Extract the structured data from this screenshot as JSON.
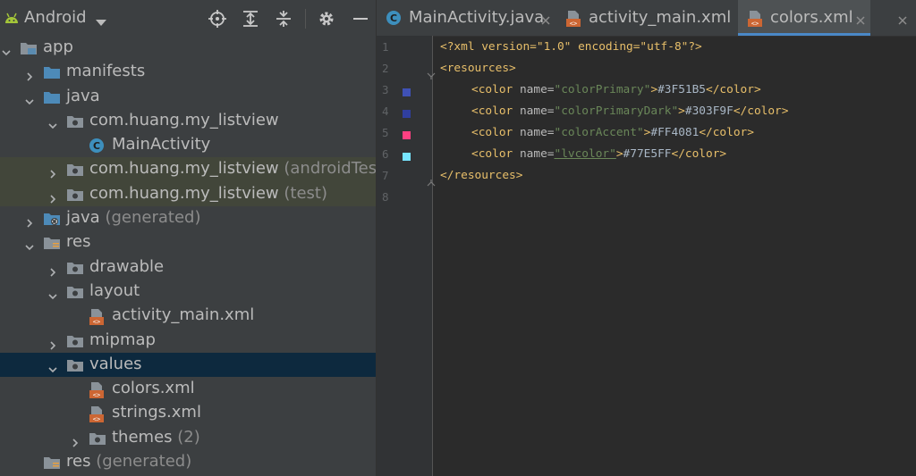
{
  "project": {
    "title": "Android",
    "tree": [
      {
        "label": "app",
        "icon": "module-folder-icon",
        "expanded": true
      },
      {
        "label": "manifests",
        "icon": "folder-icon",
        "expanded": false
      },
      {
        "label": "java",
        "icon": "folder-icon",
        "expanded": true
      },
      {
        "label": "com.huang.my_listview",
        "icon": "package-icon",
        "expanded": true
      },
      {
        "label": "MainActivity",
        "icon": "java-class-icon"
      },
      {
        "label": "com.huang.my_listview",
        "suffix": "(androidTest)",
        "icon": "package-icon",
        "expanded": false
      },
      {
        "label": "com.huang.my_listview",
        "suffix": "(test)",
        "icon": "package-icon",
        "expanded": false
      },
      {
        "label": "java",
        "suffix": "(generated)",
        "icon": "generated-folder-icon",
        "expanded": false
      },
      {
        "label": "res",
        "icon": "res-folder-icon",
        "expanded": true
      },
      {
        "label": "drawable",
        "icon": "package-icon",
        "expanded": false
      },
      {
        "label": "layout",
        "icon": "package-icon",
        "expanded": true
      },
      {
        "label": "activity_main.xml",
        "icon": "xml-file-icon"
      },
      {
        "label": "mipmap",
        "icon": "package-icon",
        "expanded": false
      },
      {
        "label": "values",
        "icon": "package-icon",
        "expanded": true
      },
      {
        "label": "colors.xml",
        "icon": "xml-file-icon"
      },
      {
        "label": "strings.xml",
        "icon": "xml-file-icon"
      },
      {
        "label": "themes",
        "suffix": "(2)",
        "icon": "package-icon",
        "expanded": false
      },
      {
        "label": "res",
        "suffix": "(generated)",
        "icon": "res-folder-icon"
      }
    ]
  },
  "editor": {
    "tabs": [
      {
        "label": "MainActivity.java",
        "icon": "java-class-icon",
        "active": false
      },
      {
        "label": "activity_main.xml",
        "icon": "xml-file-icon",
        "active": false
      },
      {
        "label": "colors.xml",
        "icon": "xml-file-icon",
        "active": true
      }
    ],
    "line_numbers": [
      "1",
      "2",
      "3",
      "4",
      "5",
      "6",
      "7",
      "8"
    ],
    "code": {
      "l1": "<?xml version=\"1.0\" encoding=\"utf-8\"?>",
      "l2": "<resources>",
      "color_open": "<color",
      "name_attr": "name=",
      "close_bracket": ">",
      "color_close": "</color>",
      "l7": "</resources>",
      "colors": [
        {
          "name": "\"colorPrimary\"",
          "value": "#3F51B5",
          "swatch": "#3F51B5"
        },
        {
          "name": "\"colorPrimaryDark\"",
          "value": "#303F9F",
          "swatch": "#303F9F"
        },
        {
          "name": "\"colorAccent\"",
          "value": "#FF4081",
          "swatch": "#FF4081"
        },
        {
          "name": "\"lvcolor\"",
          "value": "#77E5FF",
          "swatch": "#77E5FF"
        }
      ]
    }
  },
  "colors": {
    "accent": "#4a88c7",
    "selection": "#0d293e",
    "highlight": "#42463a",
    "android_green": "#a4c639"
  }
}
